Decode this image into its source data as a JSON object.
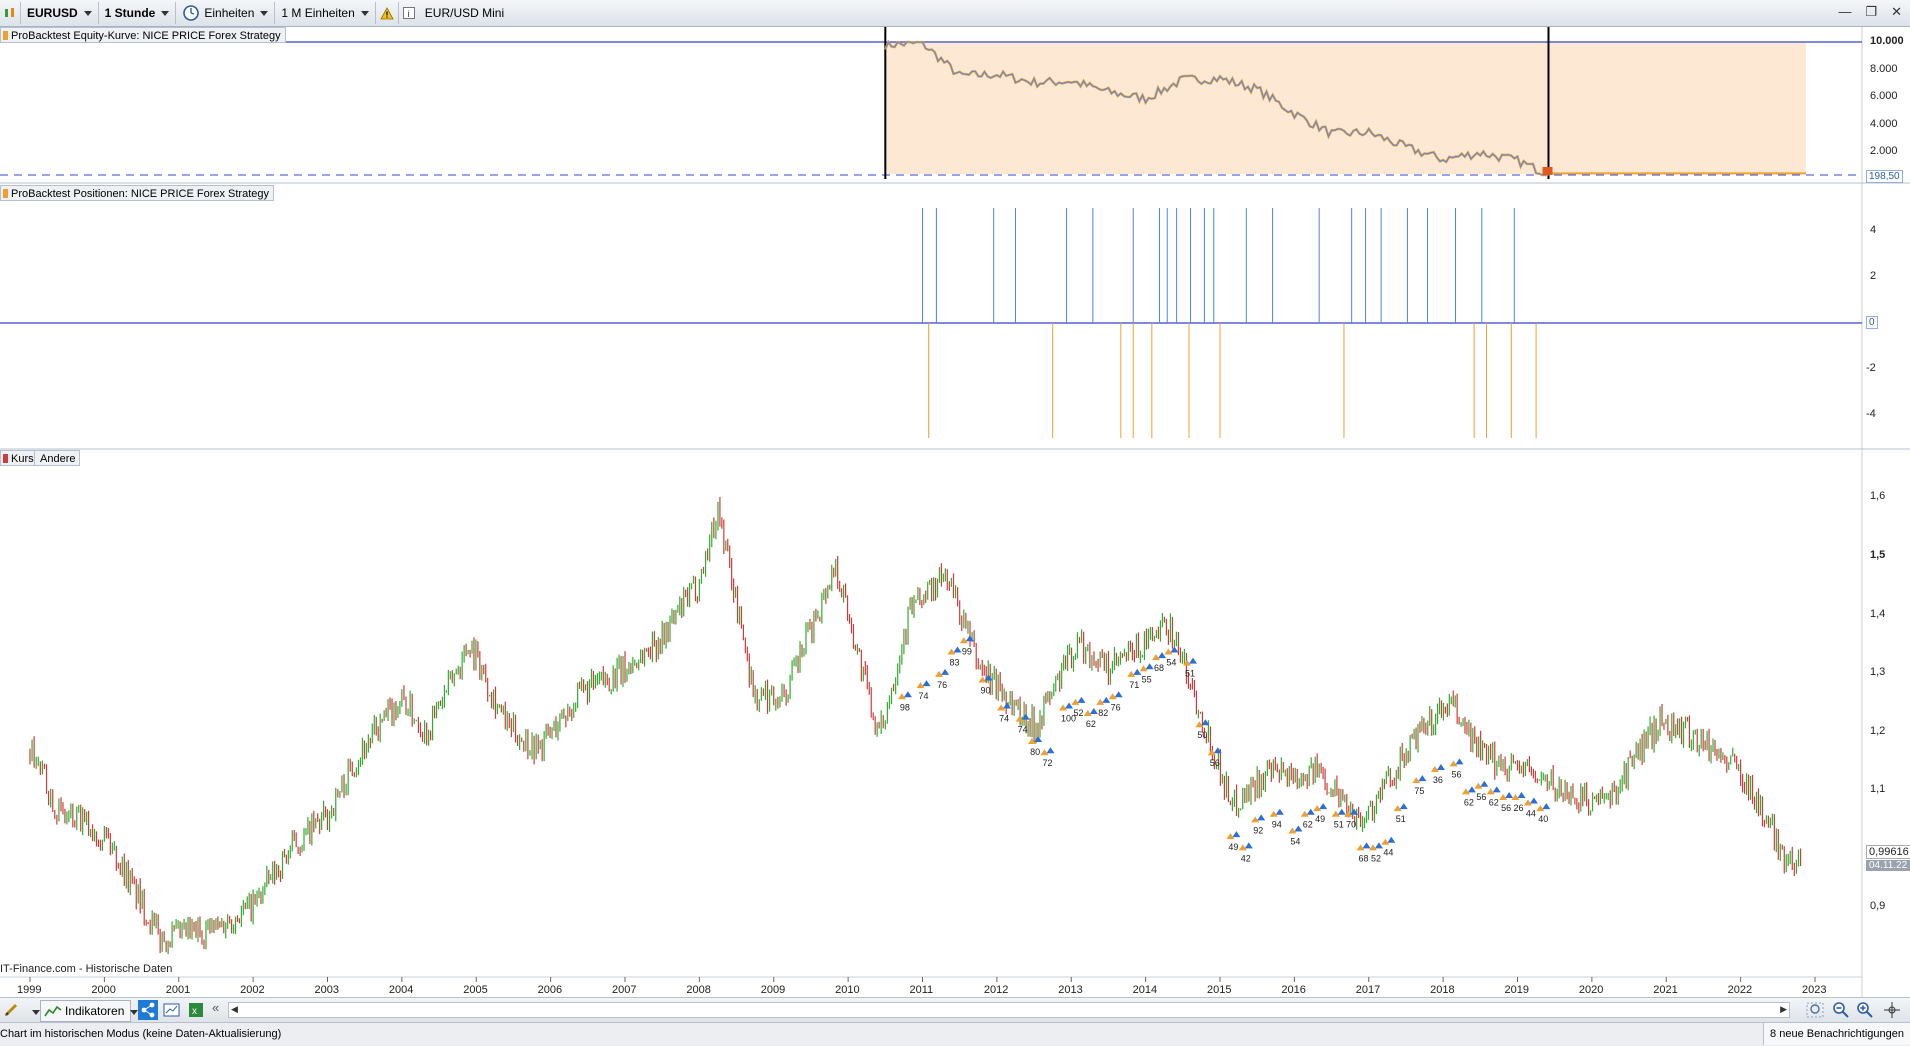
{
  "toolbar": {
    "symbol": "EURUSD",
    "timeframe": "1 Stunde",
    "units_label": "Einheiten",
    "units_count": "1 M Einheiten",
    "instrument": "EUR/USD Mini"
  },
  "panels": {
    "equity": {
      "label": "ProBacktest Equity-Kurve: NICE PRICE Forex Strategy",
      "y_ticks": [
        "10.000",
        "8.000",
        "6.000",
        "4.000",
        "2.000"
      ],
      "last_value": "198,50"
    },
    "positions": {
      "label": "ProBacktest Positionen: NICE PRICE Forex Strategy",
      "y_ticks": [
        "4",
        "2",
        "-2",
        "-4"
      ],
      "zero_label": "0"
    },
    "price": {
      "tabs": [
        "Kurs",
        "Andere"
      ],
      "y_ticks": [
        "1,6",
        "1,5",
        "1,4",
        "1,3",
        "1,2",
        "1,1",
        "0,9"
      ],
      "last_price": "0,99616",
      "last_date": "04.11.22",
      "source": "IT-Finance.com - Historische Daten"
    }
  },
  "x_axis_years": [
    "1999",
    "2000",
    "2001",
    "2002",
    "2003",
    "2004",
    "2005",
    "2006",
    "2007",
    "2008",
    "2009",
    "2010",
    "2011",
    "2012",
    "2013",
    "2014",
    "2015",
    "2016",
    "2017",
    "2018",
    "2019",
    "2020",
    "2021",
    "2022",
    "2023"
  ],
  "trade_labels": [
    "98",
    "74",
    "76",
    "83",
    "99",
    "90",
    "74",
    "74",
    "80",
    "72",
    "100",
    "52",
    "62",
    "82",
    "76",
    "71",
    "55",
    "68",
    "54",
    "51",
    "50",
    "56",
    "49",
    "42",
    "92",
    "94",
    "54",
    "62",
    "49",
    "51",
    "70",
    "68",
    "52",
    "44",
    "51",
    "75",
    "36",
    "56",
    "62",
    "56",
    "62",
    "56",
    "26",
    "44",
    "40"
  ],
  "bottom_bar": {
    "indicators_label": "Indikatoren"
  },
  "status_bar": {
    "mode_text": "Chart im historischen Modus (keine Daten-Aktualisierung)",
    "notifications": "8 neue Benachrichtigungen"
  },
  "chart_data": [
    {
      "type": "area",
      "title": "ProBacktest Equity-Kurve: NICE PRICE Forex Strategy",
      "x": [
        "2010-07",
        "2011-01",
        "2011-07",
        "2012-01",
        "2012-07",
        "2013-01",
        "2013-07",
        "2014-01",
        "2014-07",
        "2015-01",
        "2015-07",
        "2016-01",
        "2016-07",
        "2017-01",
        "2017-07",
        "2018-01",
        "2018-07",
        "2019-01",
        "2019-06"
      ],
      "values": [
        9800,
        9900,
        7500,
        7600,
        7000,
        7100,
        6300,
        5800,
        7200,
        7300,
        6500,
        4700,
        3200,
        3300,
        2200,
        1300,
        1800,
        1200,
        198.5
      ],
      "ylim": [
        0,
        10000
      ],
      "y_ticks": [
        2000,
        4000,
        6000,
        8000,
        10000
      ]
    },
    {
      "type": "bar",
      "title": "ProBacktest Positionen: NICE PRICE Forex Strategy",
      "ylim": [
        -5,
        5
      ],
      "long_positions": [
        "2011-01",
        "2011-03",
        "2011-12",
        "2012-04",
        "2012-12",
        "2013-04",
        "2013-11",
        "2014-03",
        "2014-04",
        "2014-06",
        "2014-08",
        "2014-10",
        "2014-12",
        "2015-05",
        "2015-09",
        "2016-05",
        "2016-10",
        "2016-12",
        "2017-03",
        "2017-07",
        "2017-10",
        "2018-03",
        "2018-07",
        "2018-12"
      ],
      "long_size": 5,
      "short_positions": [
        "2011-02",
        "2012-10",
        "2013-09",
        "2013-11",
        "2014-02",
        "2014-08",
        "2015-01",
        "2016-09",
        "2018-06",
        "2018-08",
        "2018-12",
        "2019-04"
      ],
      "short_size": -5
    },
    {
      "type": "line",
      "title": "EURUSD",
      "x": [
        "1999-01",
        "1999-06",
        "2000-01",
        "2000-10",
        "2001-07",
        "2002-01",
        "2002-07",
        "2003-01",
        "2003-06",
        "2004-01",
        "2004-05",
        "2004-12",
        "2005-06",
        "2005-11",
        "2006-06",
        "2007-01",
        "2007-07",
        "2008-01",
        "2008-04",
        "2008-10",
        "2009-03",
        "2009-11",
        "2010-06",
        "2010-11",
        "2011-05",
        "2011-10",
        "2012-07",
        "2013-02",
        "2013-07",
        "2014-05",
        "2015-03",
        "2015-08",
        "2016-05",
        "2016-12",
        "2017-08",
        "2018-02",
        "2018-08",
        "2019-01",
        "2019-09",
        "2020-03",
        "2020-12",
        "2021-06",
        "2022-01",
        "2022-09",
        "2022-11"
      ],
      "values": [
        1.17,
        1.05,
        1.02,
        0.83,
        0.85,
        0.89,
        0.99,
        1.05,
        1.16,
        1.26,
        1.2,
        1.36,
        1.21,
        1.17,
        1.27,
        1.31,
        1.37,
        1.47,
        1.6,
        1.26,
        1.27,
        1.5,
        1.19,
        1.42,
        1.48,
        1.32,
        1.21,
        1.36,
        1.31,
        1.39,
        1.07,
        1.12,
        1.13,
        1.04,
        1.18,
        1.25,
        1.15,
        1.14,
        1.09,
        1.07,
        1.22,
        1.19,
        1.13,
        0.96,
        0.99616
      ],
      "ylim": [
        0.83,
        1.62
      ],
      "y_ticks": [
        0.9,
        1.1,
        1.2,
        1.3,
        1.4,
        1.5,
        1.6
      ]
    }
  ]
}
